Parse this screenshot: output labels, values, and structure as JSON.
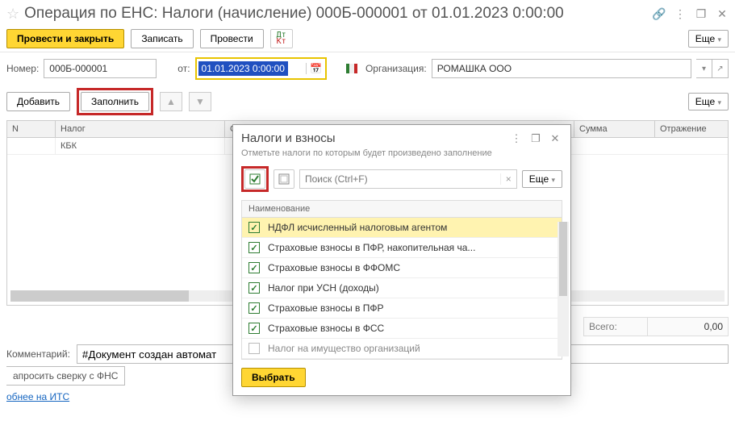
{
  "title": "Операция по ЕНС: Налоги (начисление) 000Б-000001 от 01.01.2023 0:00:00",
  "toolbar": {
    "post_close": "Провести и закрыть",
    "save": "Записать",
    "post": "Провести",
    "more": "Еще"
  },
  "form": {
    "number_label": "Номер:",
    "number_value": "000Б-000001",
    "from_label": "от:",
    "date_value": "01.01.2023  0:00:00",
    "org_label": "Организация:",
    "org_value": "РОМАШКА ООО"
  },
  "toolbar2": {
    "add": "Добавить",
    "fill": "Заполнить",
    "more": "Еще"
  },
  "grid": {
    "col_n": "N",
    "col_tax": "Налог",
    "col_kbk": "КБК",
    "col_due": "Срок уплаты",
    "col_sum": "Сумма",
    "col_ref": "Отражение"
  },
  "totals": {
    "label": "Всего:",
    "value": "0,00"
  },
  "comment": {
    "label": "Комментарий:",
    "value": "#Документ создан автомат"
  },
  "bottom": {
    "cut_btn": "апросить сверку с ФНС",
    "link": "обнее на ИТС"
  },
  "popup": {
    "title": "Налоги и взносы",
    "sub": "Отметьте налоги по которым будет произведено заполнение",
    "search_ph": "Поиск (Ctrl+F)",
    "more": "Еще",
    "head": "Наименование",
    "items": [
      "НДФЛ исчисленный налоговым агентом",
      "Страховые взносы в ПФР, накопительная ча...",
      "Страховые взносы в ФФОМС",
      "Налог при УСН (доходы)",
      "Страховые взносы в ПФР",
      "Страховые взносы в ФСС",
      "Налог на имущество организаций"
    ],
    "select_btn": "Выбрать"
  }
}
